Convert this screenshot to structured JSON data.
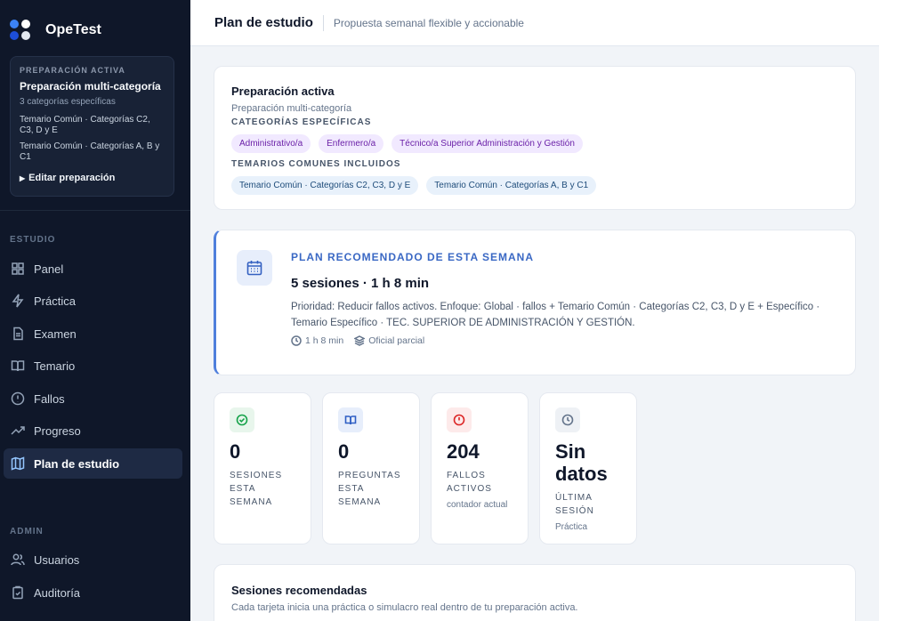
{
  "brand": {
    "name": "OpeTest"
  },
  "active_prep": {
    "kicker": "PREPARACIÓN ACTIVA",
    "title": "Preparación multi-categoría",
    "subtitle": "3 categorías específicas",
    "items": [
      "Temario Común · Categorías C2, C3, D y E",
      "Temario Común · Categorías A, B y C1"
    ],
    "edit_label": "Editar preparación"
  },
  "nav": {
    "study_label": "ESTUDIO",
    "items": [
      {
        "label": "Panel",
        "icon": "grid-icon"
      },
      {
        "label": "Práctica",
        "icon": "bolt-icon"
      },
      {
        "label": "Examen",
        "icon": "document-icon"
      },
      {
        "label": "Temario",
        "icon": "book-open-icon"
      },
      {
        "label": "Fallos",
        "icon": "alert-circle-icon"
      },
      {
        "label": "Progreso",
        "icon": "trending-up-icon"
      },
      {
        "label": "Plan de estudio",
        "icon": "map-icon"
      }
    ],
    "active_index": 6,
    "admin_label": "ADMIN",
    "admin_items": [
      {
        "label": "Usuarios",
        "icon": "users-icon"
      },
      {
        "label": "Auditoría",
        "icon": "clipboard-icon"
      }
    ]
  },
  "header": {
    "title": "Plan de estudio",
    "subtitle": "Propuesta semanal flexible y accionable"
  },
  "active_card": {
    "title": "Preparación activa",
    "subtitle": "Preparación multi-categoría",
    "specific_label": "CATEGORÍAS ESPECÍFICAS",
    "specific_chips": [
      "Administrativo/a",
      "Enfermero/a",
      "Técnico/a Superior Administración y Gestión"
    ],
    "common_label": "TEMARIOS COMUNES INCLUIDOS",
    "common_chips": [
      "Temario Común · Categorías C2, C3, D y E",
      "Temario Común · Categorías A, B y C1"
    ]
  },
  "plan": {
    "kicker": "PLAN RECOMENDADO DE ESTA SEMANA",
    "title": "5 sesiones · 1 h 8 min",
    "description": "Prioridad: Reducir fallos activos. Enfoque: Global · fallos + Temario Común · Categorías C2, C3, D y E + Específico · Temario Específico · TEC. SUPERIOR DE ADMINISTRACIÓN Y GESTIÓN.",
    "duration": "1 h 8 min",
    "mode": "Oficial parcial"
  },
  "stats": [
    {
      "value": "0",
      "label": "SESIONES ESTA SEMANA",
      "note": "",
      "icon": "check-circle-icon",
      "color": "#16a34a",
      "bg": "#e8f6ec"
    },
    {
      "value": "0",
      "label": "PREGUNTAS ESTA SEMANA",
      "note": "",
      "icon": "book-open-icon",
      "color": "#2f5fc4",
      "bg": "#e7eefb"
    },
    {
      "value": "204",
      "label": "FALLOS ACTIVOS",
      "note": "contador actual",
      "icon": "alert-circle-icon",
      "color": "#dc2626",
      "bg": "#fdeaea"
    },
    {
      "value": "Sin datos",
      "label": "ÚLTIMA SESIÓN",
      "note": "Práctica",
      "icon": "clock-icon",
      "color": "#64748b",
      "bg": "#eef1f5"
    }
  ],
  "sessions": {
    "title": "Sesiones recomendadas",
    "subtitle": "Cada tarjeta inicia una práctica o simulacro real dentro de tu preparación activa."
  }
}
